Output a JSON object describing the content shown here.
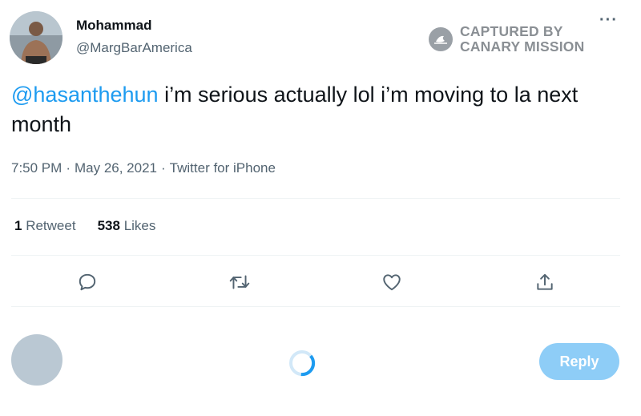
{
  "author": {
    "name": "Mohammad",
    "handle": "@MargBarAmerica"
  },
  "watermark": {
    "line1": "CAPTURED BY",
    "line2": "CANARY MISSION"
  },
  "more_menu": "···",
  "tweet": {
    "mention": "@hasanthehun",
    "text": " i’m serious actually lol i’m moving to la next month"
  },
  "meta": {
    "time": "7:50 PM",
    "date": "May 26, 2021",
    "source": "Twitter for iPhone",
    "separator": "·"
  },
  "stats": {
    "retweets_count": "1",
    "retweets_label": "Retweet",
    "likes_count": "538",
    "likes_label": "Likes"
  },
  "actions": [
    "reply-icon",
    "retweet-icon",
    "like-icon",
    "share-icon"
  ],
  "reply_box": {
    "button_label": "Reply"
  },
  "colors": {
    "accent": "#1d9bf0",
    "reply_button": "#8ecdf7",
    "muted_text": "#536471",
    "divider": "#eff3f4"
  }
}
